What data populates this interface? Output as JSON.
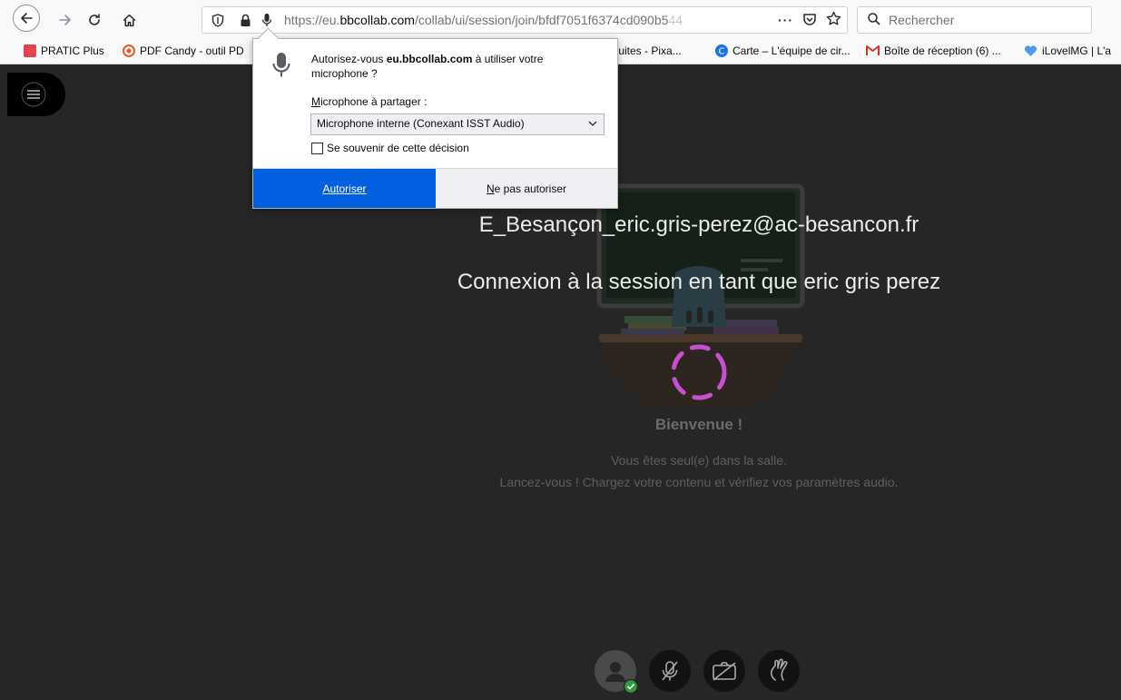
{
  "browser": {
    "url_prefix": "https://eu.",
    "url_domain": "bbcollab.com",
    "url_path": "/collab/ui/session/join/bfdf7051f6374cd090b5",
    "url_fade": "44",
    "search_placeholder": "Rechercher",
    "more_actions": "···"
  },
  "bookmarks": [
    {
      "label": "PRATIC Plus",
      "color": "#e4434f"
    },
    {
      "label": "PDF Candy - outil PD",
      "color": "#e55a2b"
    },
    {
      "label": "tuites - Pixa...",
      "color": ""
    },
    {
      "label": "Carte – L'équipe de cir...",
      "color": "#1a73e8"
    },
    {
      "label": "Boîte de réception (6) ...",
      "color": "#d93025"
    },
    {
      "label": "iLovelMG | L'a",
      "color": "#4d9be8"
    }
  ],
  "permission_popup": {
    "message_prefix": "Autorisez-vous ",
    "message_domain": "eu.bbcollab.com",
    "message_suffix": " à utiliser votre microphone ?",
    "mic_label_first": "M",
    "mic_label_rest": "icrophone à partager :",
    "selected_mic": "Microphone interne (Conexant ISST Audio)",
    "remember_label": "Se souvenir de cette décision",
    "allow_label": "Autoriser",
    "deny_label_first": "N",
    "deny_label_rest": "e pas autoriser"
  },
  "session": {
    "user_email": "E_Besançon_eric.gris-perez@ac-besancon.fr",
    "joining_as": "Connexion à la session en tant que eric gris perez",
    "welcome": "Bienvenue !",
    "alone": "Vous êtes seul(e) dans la salle.",
    "launch": "Lancez-vous ! Chargez votre contenu et vérifiez vos paramètres audio."
  },
  "colors": {
    "background": "#262626",
    "accent_purple": "#c94fd1",
    "allow_blue": "#0060df",
    "status_green": "#2e9e3e"
  }
}
